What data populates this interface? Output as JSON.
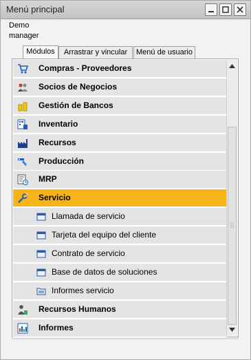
{
  "window": {
    "title": "Menú principal"
  },
  "user": {
    "line1": "Demo",
    "line2": "manager"
  },
  "tabs": [
    {
      "label": "Módulos",
      "active": true
    },
    {
      "label": "Arrastrar y vincular",
      "active": false
    },
    {
      "label": "Menú de usuario",
      "active": false
    }
  ],
  "menu": {
    "items": [
      {
        "label": "Compras - Proveedores",
        "icon": "cart-icon"
      },
      {
        "label": "Socios de Negocios",
        "icon": "people-icon"
      },
      {
        "label": "Gestión de Bancos",
        "icon": "coins-icon"
      },
      {
        "label": "Inventario",
        "icon": "inventory-icon"
      },
      {
        "label": "Recursos",
        "icon": "factory-icon"
      },
      {
        "label": "Producción",
        "icon": "production-icon"
      },
      {
        "label": "MRP",
        "icon": "mrp-icon"
      },
      {
        "label": "Servicio",
        "icon": "wrench-icon",
        "selected": true
      },
      {
        "label": "Llamada de servicio",
        "icon": "form-icon",
        "sub": true
      },
      {
        "label": "Tarjeta del equipo del cliente",
        "icon": "form-icon",
        "sub": true
      },
      {
        "label": "Contrato de servicio",
        "icon": "form-icon",
        "sub": true
      },
      {
        "label": "Base de datos de soluciones",
        "icon": "form-icon",
        "sub": true
      },
      {
        "label": "Informes servicio",
        "icon": "folder-icon",
        "sub": true
      },
      {
        "label": "Recursos Humanos",
        "icon": "hr-icon"
      },
      {
        "label": "Informes",
        "icon": "report-icon"
      }
    ]
  },
  "colors": {
    "selected_row": "#f7b419",
    "row_bg": "#e4e4e4"
  }
}
